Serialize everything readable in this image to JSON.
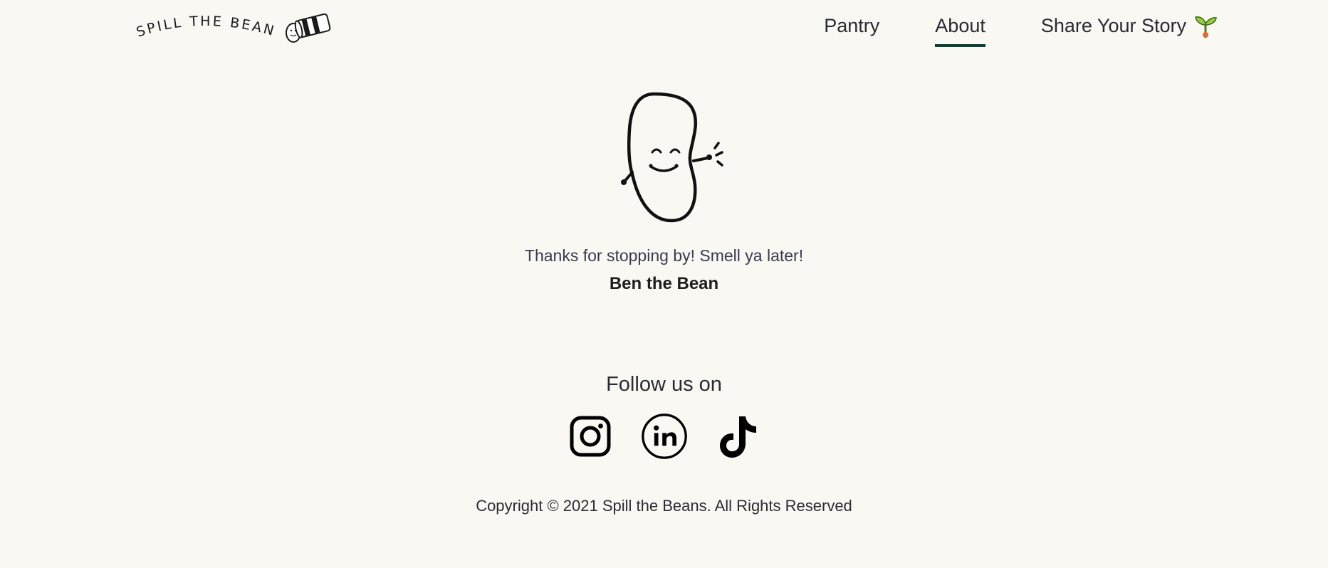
{
  "header": {
    "logo_text": "SPILL THE BEANS",
    "nav": {
      "pantry": "Pantry",
      "about": "About",
      "share": "Share Your Story"
    },
    "active_tab": "About",
    "accent_color": "#0f4034"
  },
  "main": {
    "farewell": "Thanks for stopping by! Smell ya later!",
    "signature": "Ben the Bean"
  },
  "footer": {
    "follow_label": "Follow us on",
    "socials": [
      {
        "icon": "instagram-icon"
      },
      {
        "icon": "linkedin-icon"
      },
      {
        "icon": "tiktok-icon"
      }
    ],
    "copyright": "Copyright © 2021 Spill the Beans. All Rights Reserved"
  },
  "colors": {
    "background": "#faf8f3",
    "text": "#2b2b33",
    "accent": "#0f4034"
  }
}
